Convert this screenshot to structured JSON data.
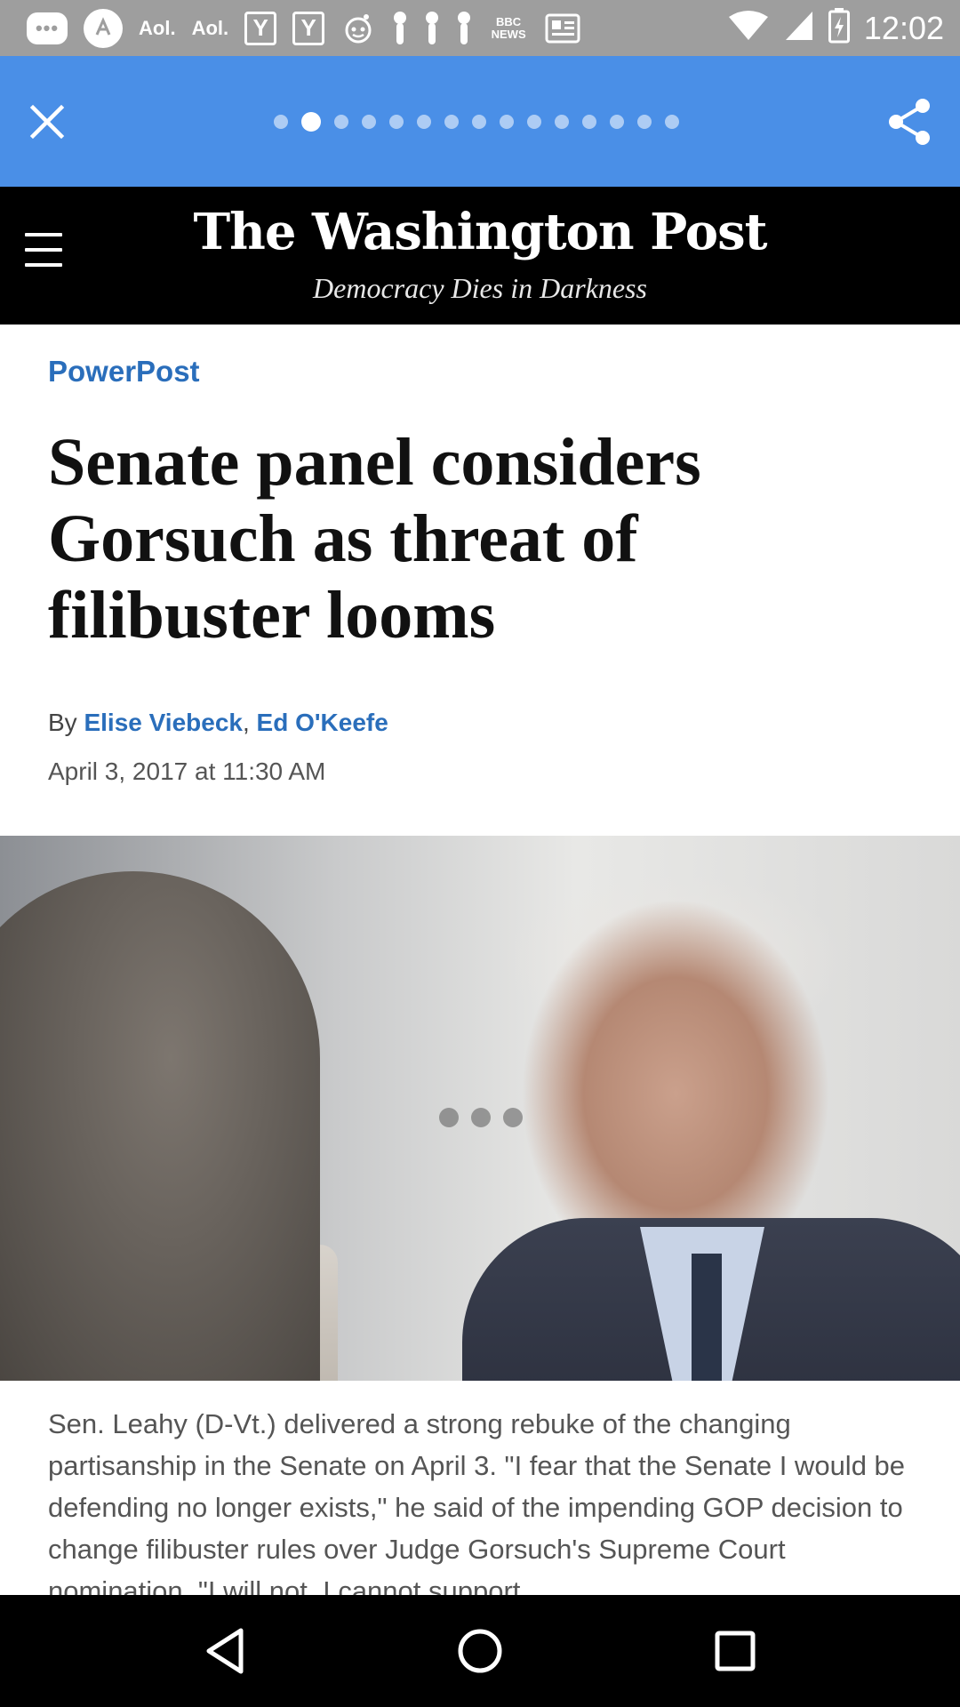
{
  "status_bar": {
    "time": "12:02",
    "notification_icons": [
      "chat-bubble-icon",
      "wiretap-icon",
      "aol-icon",
      "aol-icon",
      "yahoo-icon",
      "yahoo-icon",
      "reddit-icon",
      "pin-icon",
      "pin-icon",
      "pin-icon",
      "bbc-news-icon",
      "news-icon"
    ],
    "aol_label": "Aol.",
    "yahoo_label": "Y",
    "bbc_label": "BBC",
    "bbc_sub": "NEWS",
    "status_icons": [
      "wifi-icon",
      "signal-icon",
      "battery-icon"
    ]
  },
  "app_bar": {
    "page_count": 15,
    "active_page": 2,
    "close_icon": "close-icon",
    "share_icon": "share-icon"
  },
  "masthead": {
    "logo": "The Washington Post",
    "tagline": "Democracy Dies in Darkness",
    "menu_icon": "hamburger-menu-icon"
  },
  "article": {
    "section": "PowerPost",
    "headline": "Senate panel considers Gorsuch as threat of filibuster looms",
    "byline_prefix": "By",
    "authors": [
      "Elise Viebeck",
      "Ed O'Keefe"
    ],
    "author_separator": ",",
    "date": "April 3, 2017 at 11:30 AM",
    "caption": "Sen. Leahy (D-Vt.) delivered a strong rebuke of the changing partisanship in the Senate on April 3. \"I fear that the Senate I would be defending no longer exists,\" he said of the impending GOP decision to change filibuster rules over Judge Gorsuch's Supreme Court nomination. \"I will not. I cannot support..."
  },
  "nav_bar": {
    "back_icon": "back-triangle-icon",
    "home_icon": "home-circle-icon",
    "recents_icon": "recents-square-icon"
  }
}
